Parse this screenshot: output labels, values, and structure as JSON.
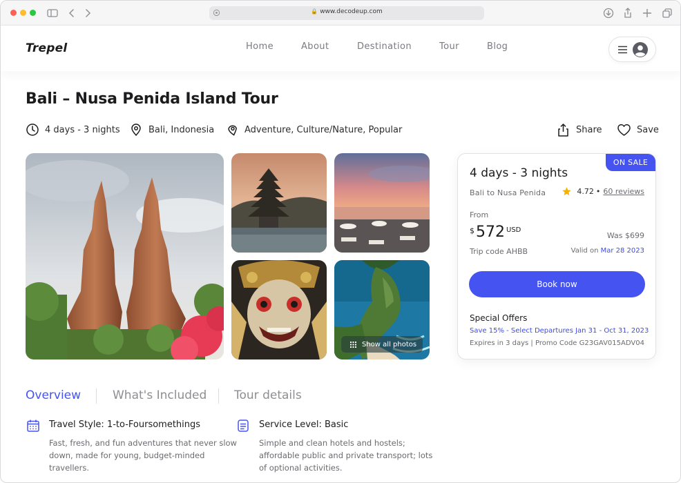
{
  "browser": {
    "url": "www.decodeup.com",
    "lock_glyph": "🔒"
  },
  "site": {
    "logo": "Trepel",
    "nav": [
      "Home",
      "About",
      "Destination",
      "Tour",
      "Blog"
    ]
  },
  "tour": {
    "title": "Bali – Nusa Penida Island Tour",
    "duration": "4 days - 3 nights",
    "location": "Bali, Indonesia",
    "categories": "Adventure, Culture/Nature, Popular",
    "share_label": "Share",
    "save_label": "Save"
  },
  "gallery": {
    "show_all_label": "Show all photos"
  },
  "booking": {
    "badge": "ON SALE",
    "duration": "4 days - 3 nights",
    "route": "Bali to Nusa Penida",
    "rating": "4.72",
    "bullet": "•",
    "reviews": "60 reviews",
    "from_label": "From",
    "currency_symbol": "$",
    "price": "572",
    "currency_code": "USD",
    "was_price": "Was $699",
    "trip_code": "Trip code AHBB",
    "valid_prefix": "Valid on",
    "valid_date": "Mar 28 2023",
    "book_label": "Book now",
    "offers_title": "Special Offers",
    "offer_line": "Save 15% - Select Departures Jan 31 - Oct 31, 2023",
    "promo_line": "Expires in 3 days | Promo Code G23GAV015ADV04"
  },
  "tabs": [
    {
      "label": "Overview",
      "active": true
    },
    {
      "label": "What's Included",
      "active": false
    },
    {
      "label": "Tour details",
      "active": false
    }
  ],
  "features": [
    {
      "icon": "calendar-icon",
      "title": "Travel Style: 1-to-Foursomethings",
      "desc_lines": [
        "Fast, fresh, and fun adventures that never slow",
        "down, made for young, budget-minded",
        "travellers."
      ]
    },
    {
      "icon": "document-icon",
      "title": "Service Level: Basic",
      "desc_lines": [
        "Simple and clean hotels and hostels;",
        "affordable public and private transport; lots",
        "of optional activities."
      ]
    }
  ],
  "colors": {
    "accent": "#4553f0",
    "link": "#3d4ae8",
    "star": "#f5b301"
  }
}
